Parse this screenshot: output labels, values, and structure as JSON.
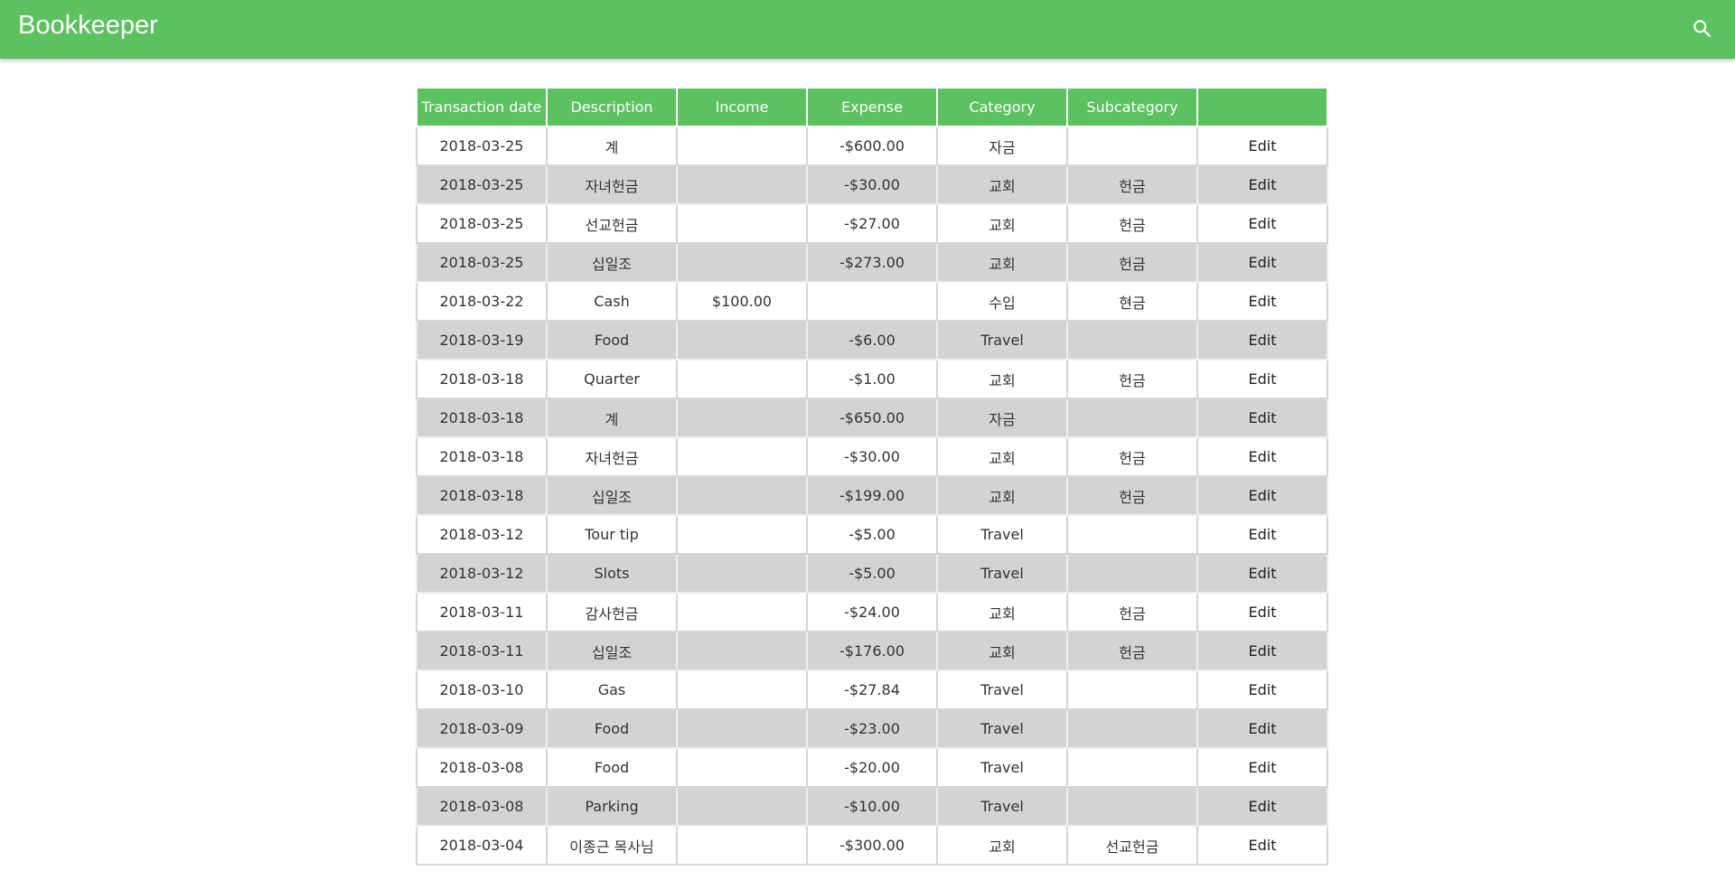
{
  "app": {
    "title": "Bookkeeper",
    "accent_color": "#5cc25f",
    "search_icon": "search-icon"
  },
  "table": {
    "columns": [
      "Transaction date",
      "Description",
      "Income",
      "Expense",
      "Category",
      "Subcategory",
      ""
    ],
    "rows": [
      {
        "date": "2018-03-25",
        "description": "계",
        "income": "",
        "expense": "-$600.00",
        "category": "자금",
        "subcategory": "",
        "action": "Edit"
      },
      {
        "date": "2018-03-25",
        "description": "자녀헌금",
        "income": "",
        "expense": "-$30.00",
        "category": "교회",
        "subcategory": "헌금",
        "action": "Edit"
      },
      {
        "date": "2018-03-25",
        "description": "선교헌금",
        "income": "",
        "expense": "-$27.00",
        "category": "교회",
        "subcategory": "헌금",
        "action": "Edit"
      },
      {
        "date": "2018-03-25",
        "description": "십일조",
        "income": "",
        "expense": "-$273.00",
        "category": "교회",
        "subcategory": "헌금",
        "action": "Edit"
      },
      {
        "date": "2018-03-22",
        "description": "Cash",
        "income": "$100.00",
        "expense": "",
        "category": "수입",
        "subcategory": "현금",
        "action": "Edit"
      },
      {
        "date": "2018-03-19",
        "description": "Food",
        "income": "",
        "expense": "-$6.00",
        "category": "Travel",
        "subcategory": "",
        "action": "Edit"
      },
      {
        "date": "2018-03-18",
        "description": "Quarter",
        "income": "",
        "expense": "-$1.00",
        "category": "교회",
        "subcategory": "헌금",
        "action": "Edit"
      },
      {
        "date": "2018-03-18",
        "description": "계",
        "income": "",
        "expense": "-$650.00",
        "category": "자금",
        "subcategory": "",
        "action": "Edit"
      },
      {
        "date": "2018-03-18",
        "description": "자녀헌금",
        "income": "",
        "expense": "-$30.00",
        "category": "교회",
        "subcategory": "헌금",
        "action": "Edit"
      },
      {
        "date": "2018-03-18",
        "description": "십일조",
        "income": "",
        "expense": "-$199.00",
        "category": "교회",
        "subcategory": "헌금",
        "action": "Edit"
      },
      {
        "date": "2018-03-12",
        "description": "Tour tip",
        "income": "",
        "expense": "-$5.00",
        "category": "Travel",
        "subcategory": "",
        "action": "Edit"
      },
      {
        "date": "2018-03-12",
        "description": "Slots",
        "income": "",
        "expense": "-$5.00",
        "category": "Travel",
        "subcategory": "",
        "action": "Edit"
      },
      {
        "date": "2018-03-11",
        "description": "감사헌금",
        "income": "",
        "expense": "-$24.00",
        "category": "교회",
        "subcategory": "헌금",
        "action": "Edit"
      },
      {
        "date": "2018-03-11",
        "description": "십일조",
        "income": "",
        "expense": "-$176.00",
        "category": "교회",
        "subcategory": "헌금",
        "action": "Edit"
      },
      {
        "date": "2018-03-10",
        "description": "Gas",
        "income": "",
        "expense": "-$27.84",
        "category": "Travel",
        "subcategory": "",
        "action": "Edit"
      },
      {
        "date": "2018-03-09",
        "description": "Food",
        "income": "",
        "expense": "-$23.00",
        "category": "Travel",
        "subcategory": "",
        "action": "Edit"
      },
      {
        "date": "2018-03-08",
        "description": "Food",
        "income": "",
        "expense": "-$20.00",
        "category": "Travel",
        "subcategory": "",
        "action": "Edit"
      },
      {
        "date": "2018-03-08",
        "description": "Parking",
        "income": "",
        "expense": "-$10.00",
        "category": "Travel",
        "subcategory": "",
        "action": "Edit"
      },
      {
        "date": "2018-03-04",
        "description": "이종근 목사님",
        "income": "",
        "expense": "-$300.00",
        "category": "교회",
        "subcategory": "선교헌금",
        "action": "Edit"
      }
    ]
  }
}
